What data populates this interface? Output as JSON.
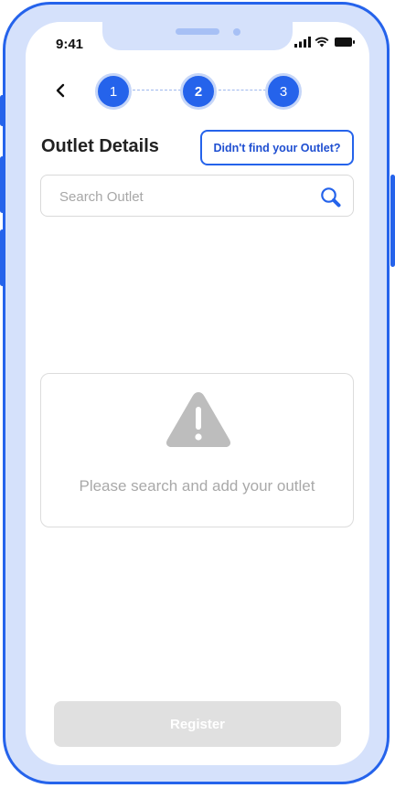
{
  "status_bar": {
    "time": "9:41"
  },
  "stepper": {
    "steps": [
      {
        "label": "1",
        "active": false
      },
      {
        "label": "2",
        "active": true
      },
      {
        "label": "3",
        "active": false
      }
    ]
  },
  "header": {
    "title": "Outlet Details",
    "not_found_button": "Didn't find your Outlet?"
  },
  "search": {
    "placeholder": "Search Outlet",
    "value": ""
  },
  "empty_state": {
    "icon": "warning-icon",
    "message": "Please search and add your outlet"
  },
  "footer": {
    "register_label": "Register",
    "register_enabled": false
  },
  "colors": {
    "accent": "#2563eb",
    "frame_fill": "#d5e1fb",
    "disabled_button": "#e0e0e0",
    "muted_text": "#a9a9a9"
  }
}
